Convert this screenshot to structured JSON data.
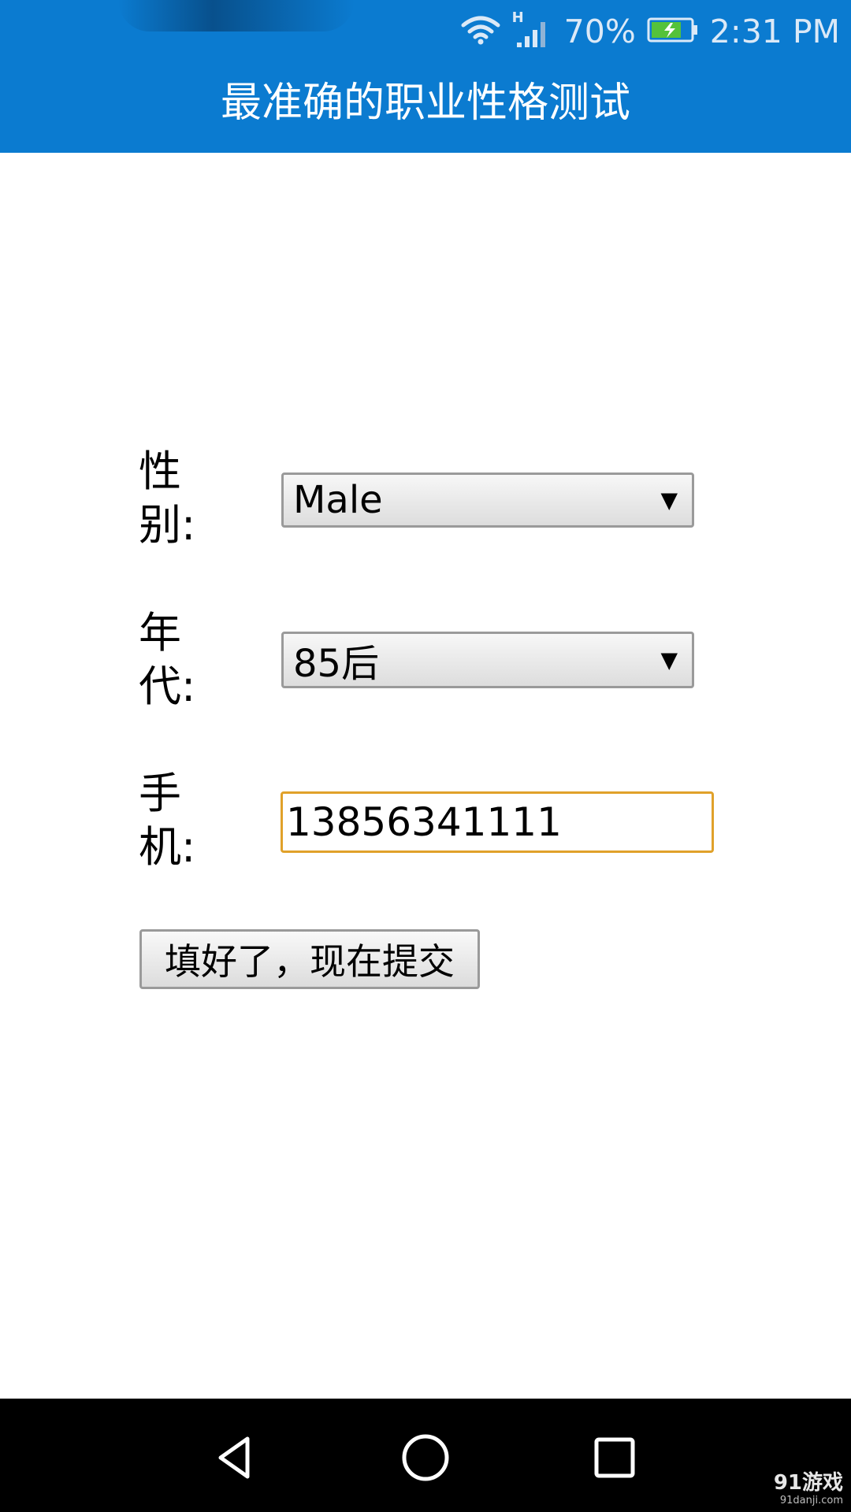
{
  "status_bar": {
    "network_type": "H",
    "battery_percent": "70%",
    "time": "2:31 PM",
    "icons": [
      "wifi-icon",
      "signal-icon",
      "battery-charging-icon"
    ]
  },
  "header": {
    "title": "最准确的职业性格测试"
  },
  "form": {
    "gender_label": "性别:",
    "gender_value": "Male",
    "generation_label": "年代:",
    "generation_value": "85后",
    "phone_label": "手机:",
    "phone_value": "13856341111",
    "submit_label": "填好了，现在提交"
  },
  "nav_bar": {
    "icons": [
      "back-icon",
      "home-icon",
      "recents-icon"
    ]
  },
  "watermark": {
    "main": "91游戏",
    "sub": "91danji.com"
  },
  "colors": {
    "header_blue": "#0b7bd0",
    "input_focus_border": "#e0a12a",
    "nav_bar": "#000000"
  }
}
